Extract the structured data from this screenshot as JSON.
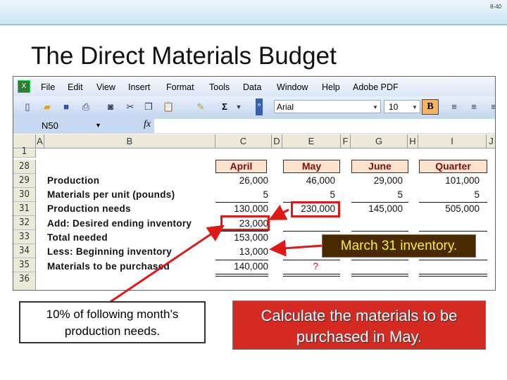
{
  "slide_number": "8-40",
  "title": "The Direct Materials Budget",
  "excel": {
    "menu": [
      "File",
      "Edit",
      "View",
      "Insert",
      "Format",
      "Tools",
      "Data",
      "Window",
      "Help",
      "Adobe PDF"
    ],
    "font": "Arial",
    "font_size": "10",
    "bold_label": "B",
    "name_box": "N50",
    "fx": "fx",
    "columns": [
      "A",
      "B",
      "C",
      "D",
      "E",
      "F",
      "G",
      "H",
      "I",
      "J"
    ],
    "rows": [
      "1",
      "28",
      "29",
      "30",
      "31",
      "32",
      "33",
      "34",
      "35",
      "36"
    ],
    "headers": [
      "April",
      "May",
      "June",
      "Quarter"
    ],
    "labels": [
      "Production",
      "Materials per unit (pounds)",
      "Production needs",
      "Add: Desired ending inventory",
      "Total needed",
      "Less: Beginning inventory",
      "Materials to be purchased"
    ],
    "april": [
      "26,000",
      "5",
      "130,000",
      "23,000",
      "153,000",
      "13,000",
      "140,000"
    ],
    "may": [
      "46,000",
      "5",
      "230,000",
      "",
      "",
      "",
      "?"
    ],
    "june": [
      "29,000",
      "5",
      "145,000",
      "",
      "",
      "",
      ""
    ],
    "quarter": [
      "101,000",
      "5",
      "505,000",
      "",
      "",
      "",
      ""
    ]
  },
  "callouts": {
    "march": "March 31 inventory.",
    "left": "10% of following month’s production needs.",
    "right": "Calculate the materials to be purchased in May."
  },
  "colors": {
    "accent_red": "#d42a22",
    "callout_brown": "#4a2800",
    "callout_text_yellow": "#ffee22"
  }
}
